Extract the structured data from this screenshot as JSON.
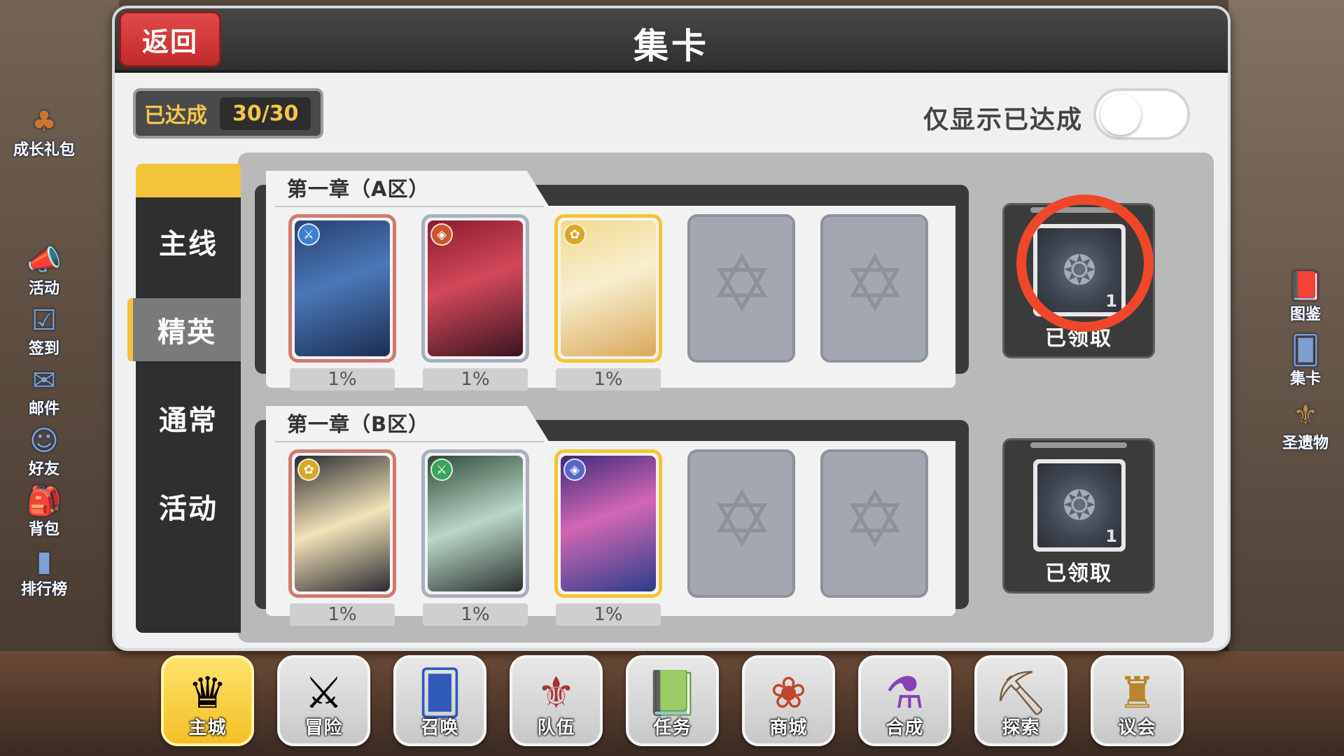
{
  "left_menu": {
    "top_item": {
      "label": "成长礼包",
      "icon": "mushroom-gift-icon"
    },
    "items": [
      {
        "label": "活动",
        "icon": "megaphone-icon"
      },
      {
        "label": "签到",
        "icon": "checkin-icon"
      },
      {
        "label": "邮件",
        "icon": "mail-icon"
      },
      {
        "label": "好友",
        "icon": "friends-icon"
      },
      {
        "label": "背包",
        "icon": "backpack-icon"
      },
      {
        "label": "排行榜",
        "icon": "ranking-icon"
      }
    ]
  },
  "right_menu": {
    "items": [
      {
        "label": "图鉴",
        "icon": "book-icon"
      },
      {
        "label": "集卡",
        "icon": "cards-icon"
      },
      {
        "label": "圣遗物",
        "icon": "relic-icon"
      }
    ]
  },
  "dialog": {
    "back_label": "返回",
    "title": "集卡",
    "achieved_label": "已达成",
    "achieved_value": "30/30",
    "filter_label": "仅显示已达成",
    "filter_on": false
  },
  "tabs": [
    {
      "label": "主线",
      "active": false
    },
    {
      "label": "精英",
      "active": true
    },
    {
      "label": "通常",
      "active": false
    },
    {
      "label": "活动",
      "active": false
    }
  ],
  "chapters": [
    {
      "title": "第一章（A区）",
      "cards": [
        {
          "rate": "1%",
          "rarity": "bronze",
          "filled": true
        },
        {
          "rate": "1%",
          "rarity": "silver",
          "filled": true
        },
        {
          "rate": "1%",
          "rarity": "gold",
          "filled": true
        },
        {
          "filled": false
        },
        {
          "filled": false
        }
      ],
      "reward": {
        "count": "1",
        "status": "已领取",
        "highlighted": true
      }
    },
    {
      "title": "第一章（B区）",
      "cards": [
        {
          "rate": "1%",
          "rarity": "bronze",
          "filled": true
        },
        {
          "rate": "1%",
          "rarity": "silver",
          "filled": true
        },
        {
          "rate": "1%",
          "rarity": "gold",
          "filled": true
        },
        {
          "filled": false
        },
        {
          "filled": false
        }
      ],
      "reward": {
        "count": "1",
        "status": "已领取",
        "highlighted": false
      }
    }
  ],
  "bottom_nav": [
    {
      "label": "主城",
      "icon": "crown-icon",
      "active": true
    },
    {
      "label": "冒险",
      "icon": "swords-icon",
      "active": false
    },
    {
      "label": "召唤",
      "icon": "summon-card-icon",
      "active": false
    },
    {
      "label": "队伍",
      "icon": "wings-emblem-icon",
      "active": false
    },
    {
      "label": "任务",
      "icon": "quest-book-icon",
      "active": false
    },
    {
      "label": "商城",
      "icon": "shop-tree-icon",
      "active": false
    },
    {
      "label": "合成",
      "icon": "potion-icon",
      "active": false
    },
    {
      "label": "探索",
      "icon": "shovel-icon",
      "active": false
    },
    {
      "label": "议会",
      "icon": "council-crest-icon",
      "active": false
    }
  ],
  "colors": {
    "accent_yellow": "#f2c43a",
    "back_red": "#d33a3a",
    "highlight_ring": "#f0472a"
  }
}
